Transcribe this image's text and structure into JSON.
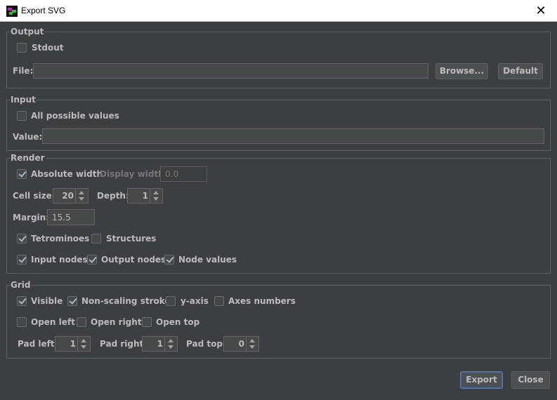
{
  "window": {
    "title": "Export SVG",
    "close_symbol": "✕"
  },
  "output": {
    "legend": "Output",
    "stdout": {
      "label": "Stdout",
      "checked": false
    },
    "file_label": "File:",
    "file_value": "",
    "browse_label": "Browse...",
    "default_label": "Default"
  },
  "input": {
    "legend": "Input",
    "all_values": {
      "label": "All possible values",
      "checked": false
    },
    "value_label": "Value:",
    "value_value": ""
  },
  "render": {
    "legend": "Render",
    "absolute_width": {
      "label": "Absolute width",
      "checked": true
    },
    "display_width_label": "Display width:",
    "display_width_value": "0.0",
    "cell_size_label": "Cell size:",
    "cell_size_value": "20",
    "depth_label": "Depth:",
    "depth_value": "1",
    "margin_label": "Margin:",
    "margin_value": "15.5",
    "tetrominoes": {
      "label": "Tetrominoes",
      "checked": true
    },
    "structures": {
      "label": "Structures",
      "checked": false
    },
    "input_nodes": {
      "label": "Input nodes",
      "checked": true
    },
    "output_nodes": {
      "label": "Output nodes",
      "checked": true
    },
    "node_values": {
      "label": "Node values",
      "checked": true
    }
  },
  "grid": {
    "legend": "Grid",
    "visible": {
      "label": "Visible",
      "checked": true
    },
    "non_scaling_stroke": {
      "label": "Non-scaling stroke",
      "checked": true
    },
    "y_axis": {
      "label": "y-axis",
      "checked": false
    },
    "axes_numbers": {
      "label": "Axes numbers",
      "checked": false
    },
    "open_left": {
      "label": "Open left",
      "checked": false
    },
    "open_right": {
      "label": "Open right",
      "checked": false
    },
    "open_top": {
      "label": "Open top",
      "checked": false
    },
    "pad_left_label": "Pad left:",
    "pad_left_value": "1",
    "pad_right_label": "Pad right:",
    "pad_right_value": "1",
    "pad_top_label": "Pad top:",
    "pad_top_value": "0"
  },
  "footer": {
    "export_label": "Export",
    "close_label": "Close"
  }
}
